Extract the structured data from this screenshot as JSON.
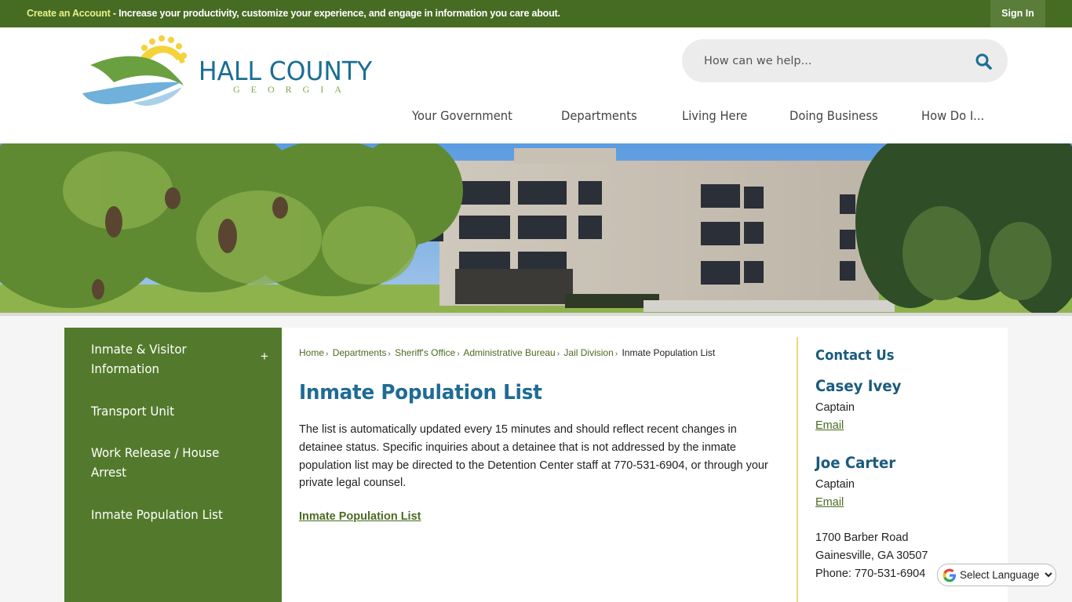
{
  "topbar": {
    "create_account_link": "Create an Account",
    "promo_text": " - Increase your productivity, customize your experience, and engage in information you care about.",
    "sign_in": "Sign In"
  },
  "header": {
    "logo_title": "HALL COUNTY",
    "logo_subtitle": "GEORGIA",
    "search_placeholder": "How can we help...",
    "search_icon": "search-icon",
    "nav": [
      {
        "label": "Your Government"
      },
      {
        "label": "Departments"
      },
      {
        "label": "Living Here"
      },
      {
        "label": "Doing Business"
      },
      {
        "label": "How Do I..."
      }
    ]
  },
  "banner": {
    "description": "Photo of pine branches with cones in front of a concrete government building under blue sky"
  },
  "sidebar": {
    "items": [
      {
        "label_line1": "Inmate & Visitor",
        "label_line2": "Information",
        "expand_icon": "+"
      },
      {
        "label_line1": "Transport Unit"
      },
      {
        "label_line1": "Work Release / House",
        "label_line2": "Arrest"
      },
      {
        "label_line1": "Inmate Population List"
      }
    ]
  },
  "breadcrumb": {
    "items": [
      "Home",
      "Departments",
      "Sheriff's Office",
      "Administrative Bureau",
      "Jail Division"
    ],
    "separator": "›",
    "current": "Inmate Population List"
  },
  "main": {
    "title": "Inmate Population List",
    "description": "The list is automatically updated every 15 minutes and should reflect recent changes in detainee status. Specific inquiries about a detainee that is not addressed by the inmate population list may be directed to the Detention Center staff at 770-531-6904, or through your private legal counsel.",
    "link": "Inmate Population List"
  },
  "contact": {
    "heading": "Contact Us",
    "people": [
      {
        "name": "Casey Ivey",
        "role": "Captain",
        "email_label": "Email"
      },
      {
        "name": "Joe Carter",
        "role": "Captain",
        "email_label": "Email"
      }
    ],
    "address_line1": "1700 Barber Road",
    "address_line2": "Gainesville, GA 30507",
    "phone": "Phone: 770-531-6904"
  },
  "language": {
    "label": "Select Language"
  },
  "colors": {
    "brand_green": "#466b23",
    "sidebar_green": "#537a2c",
    "link_green": "#4c6b22",
    "title_blue": "#1e6b95",
    "accent_yellow": "#e7d97a"
  }
}
